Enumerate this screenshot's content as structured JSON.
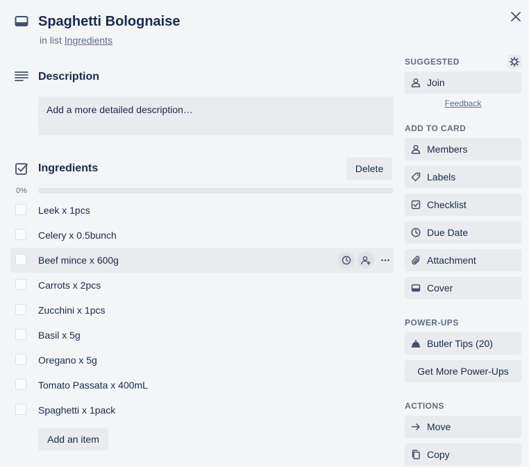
{
  "card": {
    "title": "Spaghetti Bolognaise",
    "list_prefix": "in list ",
    "list_name": "Ingredients"
  },
  "description": {
    "heading": "Description",
    "placeholder": "Add a more detailed description…"
  },
  "checklist": {
    "title": "Ingredients",
    "delete_label": "Delete",
    "progress_text": "0%",
    "progress_fraction": 0,
    "items": [
      {
        "text": "Leek x 1pcs"
      },
      {
        "text": "Celery x 0.5bunch"
      },
      {
        "text": "Beef mince x 600g"
      },
      {
        "text": "Carrots x 2pcs"
      },
      {
        "text": "Zucchini x 1pcs"
      },
      {
        "text": "Basil x 5g"
      },
      {
        "text": "Oregano x 5g"
      },
      {
        "text": "Tomato Passata x 400mL"
      },
      {
        "text": "Spaghetti x 1pack"
      }
    ],
    "add_item_label": "Add an item"
  },
  "sidebar": {
    "suggested": {
      "heading": "SUGGESTED",
      "join_label": "Join",
      "feedback_label": "Feedback"
    },
    "add_to_card": {
      "heading": "ADD TO CARD",
      "members": "Members",
      "labels": "Labels",
      "checklist": "Checklist",
      "due_date": "Due Date",
      "attachment": "Attachment",
      "cover": "Cover"
    },
    "power_ups": {
      "heading": "POWER-UPS",
      "butler": "Butler Tips (20)",
      "get_more": "Get More Power-Ups"
    },
    "actions": {
      "heading": "ACTIONS",
      "move": "Move",
      "copy": "Copy"
    }
  },
  "icons": {
    "card": "card-icon",
    "close": "close-icon",
    "description": "description-icon",
    "checklist": "checkbox-icon",
    "gear": "gear-icon",
    "member": "person-icon",
    "label": "tag-icon",
    "clock": "clock-icon",
    "paperclip": "paperclip-icon",
    "cover": "cover-icon",
    "butler": "butler-bell-icon",
    "arrow": "arrow-right-icon",
    "copy": "copy-icon",
    "more": "ellipsis-icon"
  },
  "colors": {
    "text": "#172b4d",
    "subtle": "#5e6c84",
    "background": "#f4f5f7",
    "button": "#e9ebee"
  }
}
